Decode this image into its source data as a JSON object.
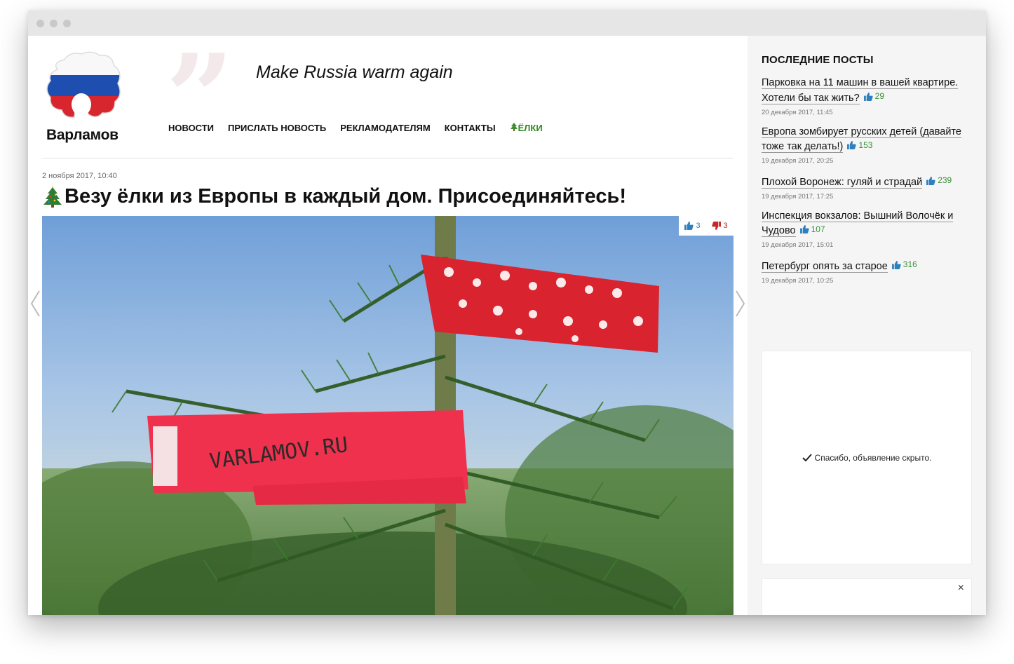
{
  "header": {
    "logo_text": "Варламов",
    "slogan": "Make Russia warm again",
    "nav": [
      {
        "label": "НОВОСТИ"
      },
      {
        "label": "ПРИСЛАТЬ НОВОСТЬ"
      },
      {
        "label": "РЕКЛАМОДАТЕЛЯМ"
      },
      {
        "label": "КОНТАКТЫ"
      },
      {
        "label": "ЁЛКИ",
        "icon": "tree-icon",
        "color": "#2e8b1e"
      }
    ]
  },
  "article": {
    "date": "2 ноября 2017, 10:40",
    "title": "Везу ёлки из Европы в каждый дом. Присоединяйтесь!",
    "votes_up": "3",
    "votes_down": "3",
    "photo_tag_text": "VARLAMOV.RU"
  },
  "sidebar": {
    "title": "ПОСЛЕДНИЕ ПОСТЫ",
    "posts": [
      {
        "title": "Парковка на 11 машин в вашей квартире. Хотели бы так жить?",
        "likes": "29",
        "time": "20 декабря 2017, 11:45"
      },
      {
        "title": "Европа зомбирует русских детей (давайте тоже так делать!)",
        "likes": "153",
        "time": "19 декабря 2017, 20:25"
      },
      {
        "title": "Плохой Воронеж: гуляй и страдай",
        "likes": "239",
        "time": "19 декабря 2017, 17:25"
      },
      {
        "title": "Инспекция вокзалов: Вышний Волочёк и Чудово",
        "likes": "107",
        "time": "19 декабря 2017, 15:01"
      },
      {
        "title": "Петербург опять за старое",
        "likes": "316",
        "time": "19 декабря 2017, 10:25"
      }
    ],
    "ad_hidden_message": "Спасибо, объявление скрыто.",
    "ad2_close": "×"
  },
  "colors": {
    "accent_green": "#2e8b1e",
    "like_blue": "#2e7fbf",
    "dislike_red": "#c62828"
  }
}
